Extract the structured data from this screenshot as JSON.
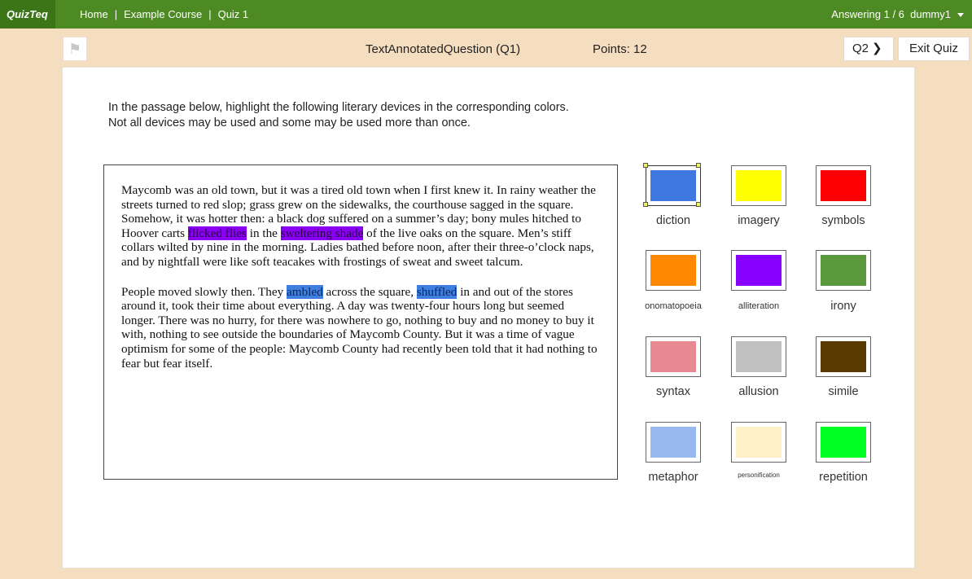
{
  "nav": {
    "logo": "QuizTeq",
    "crumbs": [
      "Home",
      "Example Course",
      "Quiz 1"
    ],
    "sep": "|",
    "status": "Answering 1 / 6",
    "user": "dummy1"
  },
  "question": {
    "title": "TextAnnotatedQuestion (Q1)",
    "points": "Points: 12",
    "next_label": "Q2",
    "exit_label": "Exit Quiz",
    "flag_icon": "flag-icon"
  },
  "instructions": [
    "In the passage below, highlight the following literary devices in the corresponding colors.",
    "Not all devices may be used and some may be used more than once."
  ],
  "passage": {
    "p1": [
      {
        "text": "Maycomb was an old town, but it was a tired old town when I first knew it. In rainy weather the streets turned to red slop; grass grew on the sidewalks, the courthouse sagged in the square. Somehow, it was hotter then: a black dog suffered on a summer’s day; bony mules hitched to Hoover carts ",
        "hl": ""
      },
      {
        "text": "flicked flies",
        "hl": "purple"
      },
      {
        "text": " in the ",
        "hl": ""
      },
      {
        "text": "sweltering shade",
        "hl": "purple"
      },
      {
        "text": " of the live oaks on the square. Men’s stiff collars wilted by nine in the morning. Ladies bathed before noon, after their three-o’clock naps, and by nightfall were like soft teacakes with frostings of sweat and sweet talcum.",
        "hl": ""
      }
    ],
    "p2": [
      {
        "text": "People moved slowly then. They ",
        "hl": ""
      },
      {
        "text": "ambled",
        "hl": "blue"
      },
      {
        "text": " across the square, ",
        "hl": ""
      },
      {
        "text": "shuffled",
        "hl": "blue"
      },
      {
        "text": " in and out of the stores around it, took their time about everything. A day was twenty-four hours long but seemed longer. There was no hurry, for there was nowhere to go, nothing to buy and no money to buy it with, nothing to see outside the boundaries of Maycomb County. But it was a time of vague optimism for some of the people: Maycomb County had recently been told that it had nothing to fear but fear itself.",
        "hl": ""
      }
    ]
  },
  "devices": [
    {
      "label": "diction",
      "color": "#3f78e0",
      "selected": true,
      "size": "normal"
    },
    {
      "label": "imagery",
      "color": "#ffff00",
      "selected": false,
      "size": "normal"
    },
    {
      "label": "symbols",
      "color": "#ff0000",
      "selected": false,
      "size": "normal"
    },
    {
      "label": "onomatopoeia",
      "color": "#ff8800",
      "selected": false,
      "size": "small"
    },
    {
      "label": "alliteration",
      "color": "#8800ff",
      "selected": false,
      "size": "small"
    },
    {
      "label": "irony",
      "color": "#5a9a3c",
      "selected": false,
      "size": "normal"
    },
    {
      "label": "syntax",
      "color": "#e88890",
      "selected": false,
      "size": "normal"
    },
    {
      "label": "allusion",
      "color": "#c0c0c0",
      "selected": false,
      "size": "normal"
    },
    {
      "label": "simile",
      "color": "#5a3a00",
      "selected": false,
      "size": "normal"
    },
    {
      "label": "metaphor",
      "color": "#98b8f0",
      "selected": false,
      "size": "normal"
    },
    {
      "label": "personification",
      "color": "#fff0c8",
      "selected": false,
      "size": "tiny"
    },
    {
      "label": "repetition",
      "color": "#00ff22",
      "selected": false,
      "size": "normal"
    }
  ]
}
